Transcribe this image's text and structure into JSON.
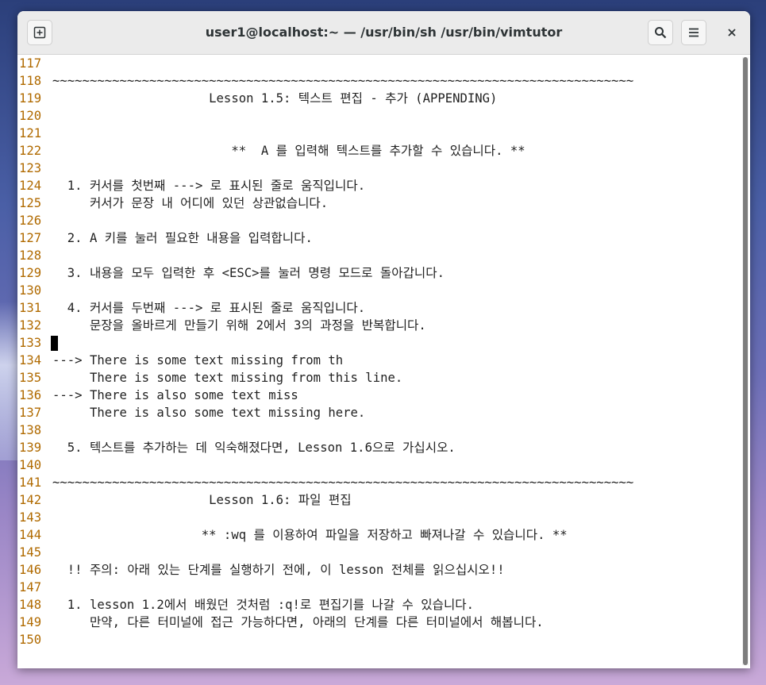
{
  "window": {
    "title": "user1@localhost:~ — /usr/bin/sh /usr/bin/vimtutor"
  },
  "terminal": {
    "cursor_line": 133,
    "lines": [
      {
        "n": "117",
        "t": ""
      },
      {
        "n": "118",
        "t": "~~~~~~~~~~~~~~~~~~~~~~~~~~~~~~~~~~~~~~~~~~~~~~~~~~~~~~~~~~~~~~~~~~~~~~~~~~~~~~"
      },
      {
        "n": "119",
        "t": "                     Lesson 1.5: 텍스트 편집 - 추가 (APPENDING)"
      },
      {
        "n": "120",
        "t": ""
      },
      {
        "n": "121",
        "t": ""
      },
      {
        "n": "122",
        "t": "                        **  A 를 입력해 텍스트를 추가할 수 있습니다. **"
      },
      {
        "n": "123",
        "t": ""
      },
      {
        "n": "124",
        "t": "  1. 커서를 첫번째 ---> 로 표시된 줄로 움직입니다."
      },
      {
        "n": "125",
        "t": "     커서가 문장 내 어디에 있던 상관없습니다."
      },
      {
        "n": "126",
        "t": ""
      },
      {
        "n": "127",
        "t": "  2. A 키를 눌러 필요한 내용을 입력합니다."
      },
      {
        "n": "128",
        "t": ""
      },
      {
        "n": "129",
        "t": "  3. 내용을 모두 입력한 후 <ESC>를 눌러 명령 모드로 돌아갑니다."
      },
      {
        "n": "130",
        "t": ""
      },
      {
        "n": "131",
        "t": "  4. 커서를 두번째 ---> 로 표시된 줄로 움직입니다."
      },
      {
        "n": "132",
        "t": "     문장을 올바르게 만들기 위해 2에서 3의 과정을 반복합니다."
      },
      {
        "n": "133",
        "t": ""
      },
      {
        "n": "134",
        "t": "---> There is some text missing from th"
      },
      {
        "n": "135",
        "t": "     There is some text missing from this line."
      },
      {
        "n": "136",
        "t": "---> There is also some text miss"
      },
      {
        "n": "137",
        "t": "     There is also some text missing here."
      },
      {
        "n": "138",
        "t": ""
      },
      {
        "n": "139",
        "t": "  5. 텍스트를 추가하는 데 익숙해졌다면, Lesson 1.6으로 가십시오."
      },
      {
        "n": "140",
        "t": ""
      },
      {
        "n": "141",
        "t": "~~~~~~~~~~~~~~~~~~~~~~~~~~~~~~~~~~~~~~~~~~~~~~~~~~~~~~~~~~~~~~~~~~~~~~~~~~~~~~"
      },
      {
        "n": "142",
        "t": "                     Lesson 1.6: 파일 편집"
      },
      {
        "n": "143",
        "t": ""
      },
      {
        "n": "144",
        "t": "                    ** :wq 를 이용하여 파일을 저장하고 빠져나갈 수 있습니다. **"
      },
      {
        "n": "145",
        "t": ""
      },
      {
        "n": "146",
        "t": "  !! 주의: 아래 있는 단계를 실행하기 전에, 이 lesson 전체를 읽으십시오!!"
      },
      {
        "n": "147",
        "t": ""
      },
      {
        "n": "148",
        "t": "  1. lesson 1.2에서 배웠던 것처럼 :q!로 편집기를 나갈 수 있습니다."
      },
      {
        "n": "149",
        "t": "     만약, 다른 터미널에 접근 가능하다면, 아래의 단계를 다른 터미널에서 해봅니다."
      },
      {
        "n": "150",
        "t": ""
      }
    ]
  },
  "icons": {
    "new_tab": "new-tab-icon",
    "search": "search-icon",
    "menu": "hamburger-menu-icon",
    "close": "close-icon"
  },
  "colors": {
    "line_number": "#b06a00",
    "text": "#222222",
    "titlebar": "#ebebeb"
  }
}
